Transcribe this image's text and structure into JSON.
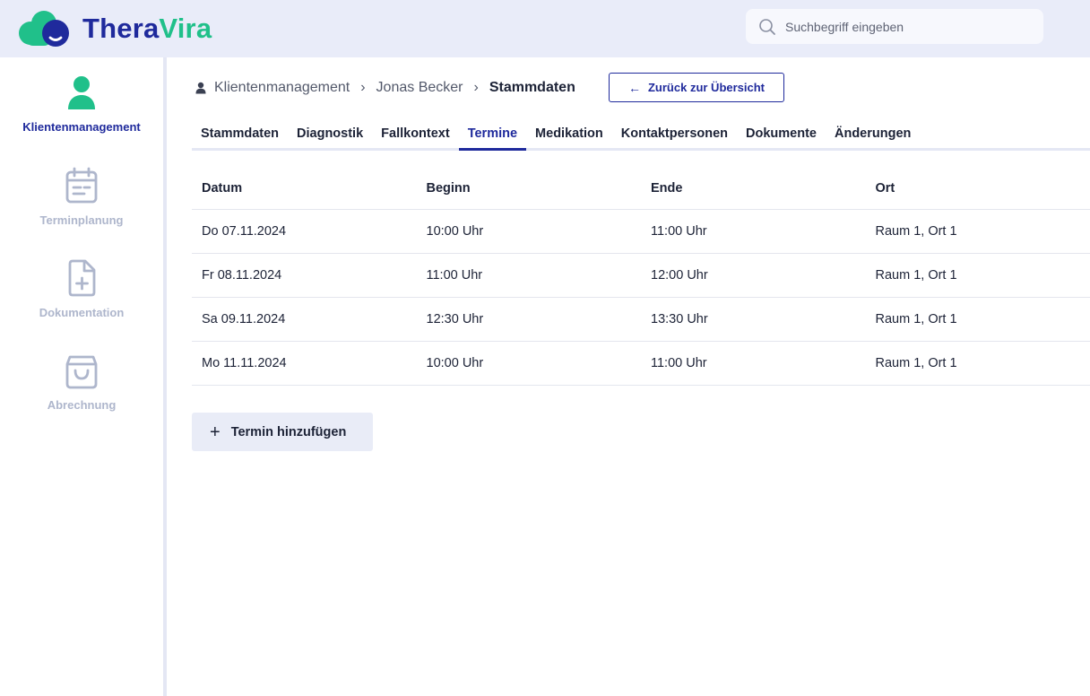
{
  "app": {
    "name_part1": "Thera",
    "name_part2": "Vira"
  },
  "colors": {
    "brand_blue": "#1f2a9c",
    "brand_green": "#20c08a",
    "topbar_bg": "#e9ecf9",
    "inactive_nav": "#aeb6cc"
  },
  "search": {
    "placeholder": "Suchbegriff eingeben",
    "value": ""
  },
  "sidebar": {
    "items": [
      {
        "label": "Klientenmanagement",
        "icon": "user-icon",
        "active": true
      },
      {
        "label": "Terminplanung",
        "icon": "calendar-icon",
        "active": false
      },
      {
        "label": "Dokumentation",
        "icon": "document-add-icon",
        "active": false
      },
      {
        "label": "Abrechnung",
        "icon": "shopping-bag-icon",
        "active": false
      }
    ]
  },
  "breadcrumb": {
    "items": [
      "Klientenmanagement",
      "Jonas Becker",
      "Stammdaten"
    ],
    "separator": "›"
  },
  "back_button": {
    "label": "Zurück zur Übersicht",
    "arrow": "←"
  },
  "tabs": [
    "Stammdaten",
    "Diagnostik",
    "Fallkontext",
    "Termine",
    "Medikation",
    "Kontaktpersonen",
    "Dokumente",
    "Änderungen"
  ],
  "active_tab": "Termine",
  "table": {
    "columns": [
      "Datum",
      "Beginn",
      "Ende",
      "Ort"
    ],
    "rows": [
      [
        "Do 07.11.2024",
        "10:00 Uhr",
        "11:00 Uhr",
        "Raum 1, Ort 1"
      ],
      [
        "Fr 08.11.2024",
        "11:00 Uhr",
        "12:00 Uhr",
        "Raum 1, Ort 1"
      ],
      [
        "Sa 09.11.2024",
        "12:30 Uhr",
        "13:30 Uhr",
        "Raum 1, Ort 1"
      ],
      [
        "Mo 11.11.2024",
        "10:00 Uhr",
        "11:00 Uhr",
        "Raum 1, Ort 1"
      ]
    ]
  },
  "add_button": {
    "label": "Termin hinzufügen",
    "icon_glyph": "+"
  }
}
